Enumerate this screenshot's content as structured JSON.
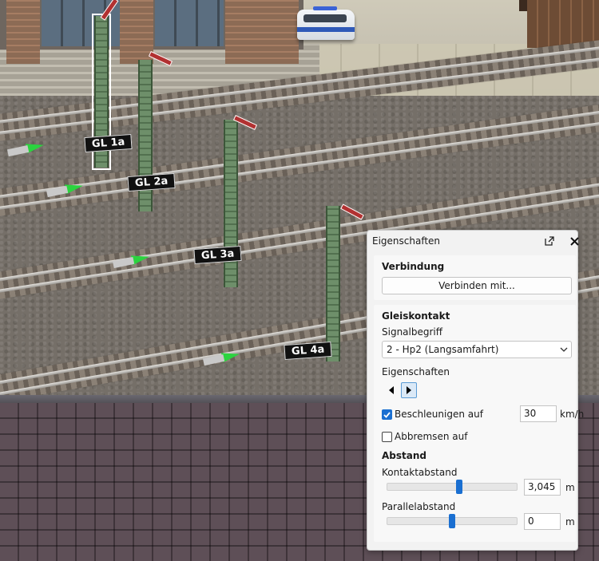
{
  "scene": {
    "track_plates": [
      "GL 1a",
      "GL 2a",
      "GL 3a",
      "GL 4a"
    ]
  },
  "panel": {
    "title": "Eigenschaften",
    "popout_icon": "popout-icon",
    "close_icon": "close-icon",
    "connection": {
      "title": "Verbindung",
      "button_label": "Verbinden mit..."
    },
    "contact": {
      "title": "Gleiskontakt",
      "signal_label": "Signalbegriff",
      "signal_value": "2 - Hp2 (Langsamfahrt)",
      "properties_label": "Eigenschaften",
      "accelerate_label": "Beschleunigen auf",
      "accelerate_checked": true,
      "accelerate_value": "30",
      "speed_unit": "km/h",
      "brake_label": "Abbremsen auf",
      "brake_checked": false
    },
    "distance": {
      "title": "Abstand",
      "contact_label": "Kontaktabstand",
      "contact_value": "3,045",
      "contact_unit": "m",
      "contact_slider_fraction": 0.56,
      "parallel_label": "Parallelabstand",
      "parallel_value": "0",
      "parallel_unit": "m",
      "parallel_slider_fraction": 0.5
    },
    "accent_color": "#1a6fd1"
  }
}
